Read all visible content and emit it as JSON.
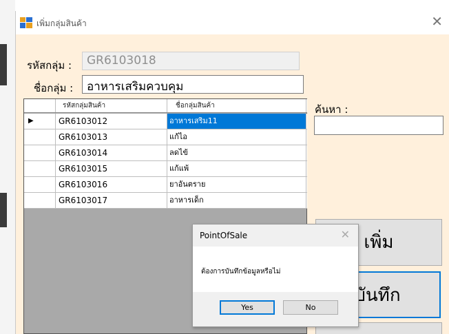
{
  "window": {
    "title": "เพิ่มกลุ่มสินค้า"
  },
  "form": {
    "group_code_label": "รหัสกลุ่ม :",
    "group_code_value": "GR6103018",
    "group_name_label": "ชื่อกลุ่ม :",
    "group_name_value": "อาหารเสริมควบคุม",
    "search_label": "ค้นหา :",
    "search_value": ""
  },
  "grid": {
    "columns": [
      "รหัสกลุ่มสินค้า",
      "ชื่อกลุ่มสินค้า"
    ],
    "rows": [
      {
        "indicator": "▶",
        "code": "GR6103012",
        "name": "อาหารเสริม11"
      },
      {
        "indicator": "",
        "code": "GR6103013",
        "name": "แก้ไอ"
      },
      {
        "indicator": "",
        "code": "GR6103014",
        "name": "ลดไข้"
      },
      {
        "indicator": "",
        "code": "GR6103015",
        "name": "แก้แพ้"
      },
      {
        "indicator": "",
        "code": "GR6103016",
        "name": "ยาอันตราย"
      },
      {
        "indicator": "",
        "code": "GR6103017",
        "name": "อาหารเด็ก"
      }
    ]
  },
  "buttons": {
    "add": "เพิ่ม",
    "save": "บันทึก"
  },
  "dialog": {
    "title": "PointOfSale",
    "message": "ต้องการบันทึกข้อมูลหรือไม่",
    "yes": "Yes",
    "no": "No"
  },
  "colors": {
    "form_bg": "#fff0dc",
    "selection": "#0078d7",
    "grid_bg": "#a9a9a9"
  }
}
